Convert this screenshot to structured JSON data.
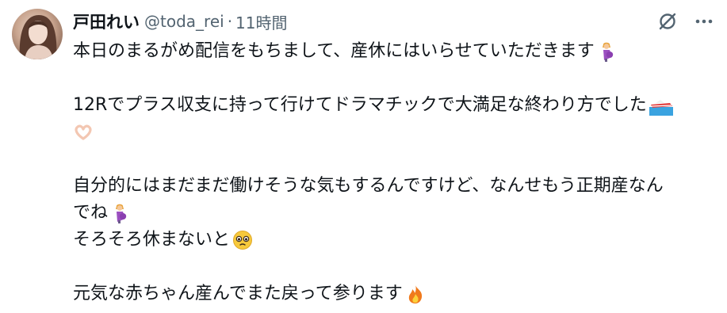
{
  "tweet": {
    "author": {
      "display_name": "戸田れい",
      "handle": "@toda_rei",
      "separator": "·",
      "timestamp": "11時間"
    },
    "actions": {
      "grok_icon": "grok-icon",
      "more_icon": "more-icon"
    },
    "text": {
      "line1": "本日のまるがめ配信をもちまして、産休にはいらせていただきます",
      "line2": "12Rでプラス収支に持って行けてドラマチックで大満足な終わり方でした",
      "line4": "自分的にはまだまだ働けそうな気もするんですけど、なんせもう正期産なん",
      "line5": "でね",
      "line6": "そろそろ休まないと",
      "line7": "元気な赤ちゃん産んでまた戻って参ります"
    },
    "emojis": {
      "pregnant": "pregnant-woman-emoji",
      "boat": "speedboat-emoji",
      "heart_hands": "heart-hands-emoji",
      "teary": "holding-back-tears-emoji",
      "fire": "fire-emoji"
    },
    "colors": {
      "text": "#0f1419",
      "secondary": "#536471"
    }
  }
}
